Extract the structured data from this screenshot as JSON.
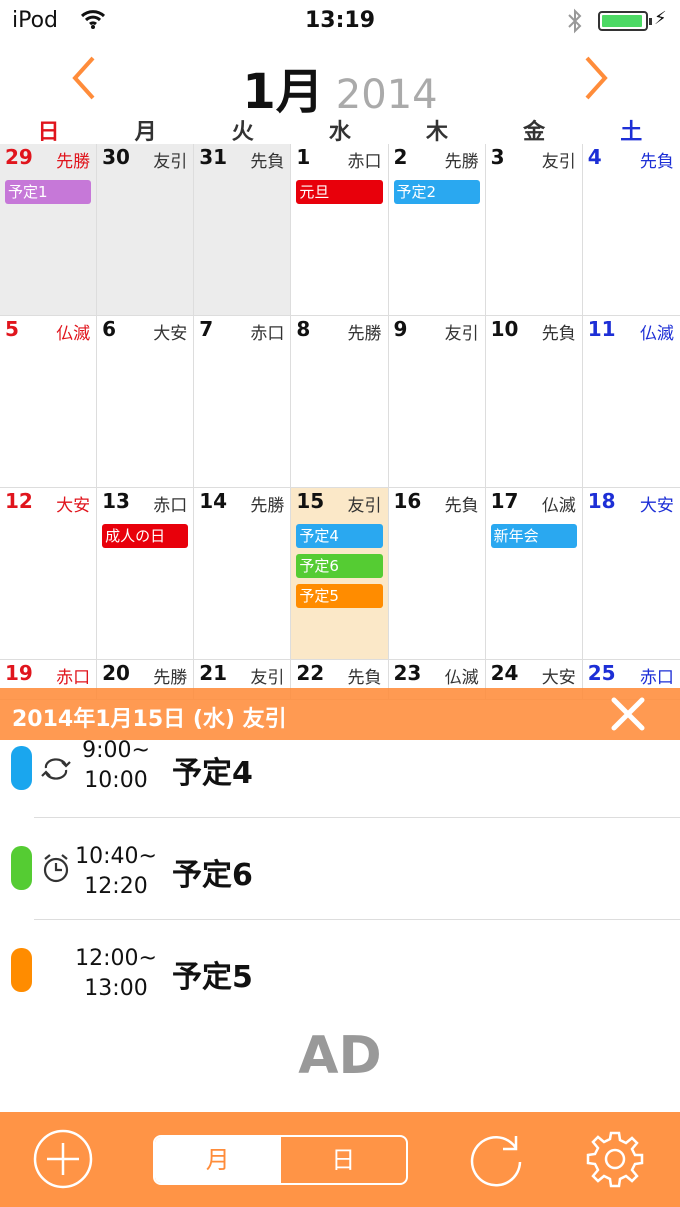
{
  "status_bar": {
    "carrier": "iPod",
    "time": "13:19"
  },
  "header": {
    "month": "1月",
    "year": "2014"
  },
  "weekdays": [
    "日",
    "月",
    "火",
    "水",
    "木",
    "金",
    "土"
  ],
  "weeks": [
    [
      {
        "num": "29",
        "rokuyo": "先勝",
        "events": [
          {
            "label": "予定1",
            "color": "#c678d8"
          }
        ]
      },
      {
        "num": "30",
        "rokuyo": "友引"
      },
      {
        "num": "31",
        "rokuyo": "先負"
      },
      {
        "num": "1",
        "rokuyo": "赤口",
        "events": [
          {
            "label": "元旦",
            "color": "#e8000b"
          }
        ]
      },
      {
        "num": "2",
        "rokuyo": "先勝",
        "events": [
          {
            "label": "予定2",
            "color": "#2aa8f0"
          }
        ]
      },
      {
        "num": "3",
        "rokuyo": "友引"
      },
      {
        "num": "4",
        "rokuyo": "先負"
      }
    ],
    [
      {
        "num": "5",
        "rokuyo": "仏滅"
      },
      {
        "num": "6",
        "rokuyo": "大安"
      },
      {
        "num": "7",
        "rokuyo": "赤口"
      },
      {
        "num": "8",
        "rokuyo": "先勝"
      },
      {
        "num": "9",
        "rokuyo": "友引"
      },
      {
        "num": "10",
        "rokuyo": "先負"
      },
      {
        "num": "11",
        "rokuyo": "仏滅"
      }
    ],
    [
      {
        "num": "12",
        "rokuyo": "大安"
      },
      {
        "num": "13",
        "rokuyo": "赤口",
        "events": [
          {
            "label": "成人の日",
            "color": "#e8000b"
          }
        ]
      },
      {
        "num": "14",
        "rokuyo": "先勝"
      },
      {
        "num": "15",
        "rokuyo": "友引",
        "events": [
          {
            "label": "予定4",
            "color": "#2aa8f0"
          },
          {
            "label": "予定6",
            "color": "#55cc33"
          },
          {
            "label": "予定5",
            "color": "#ff8c00"
          }
        ]
      },
      {
        "num": "16",
        "rokuyo": "先負"
      },
      {
        "num": "17",
        "rokuyo": "仏滅",
        "events": [
          {
            "label": "新年会",
            "color": "#2aa8f0"
          }
        ]
      },
      {
        "num": "18",
        "rokuyo": "大安"
      }
    ],
    [
      {
        "num": "19",
        "rokuyo": "赤口"
      },
      {
        "num": "20",
        "rokuyo": "先勝"
      },
      {
        "num": "21",
        "rokuyo": "友引"
      },
      {
        "num": "22",
        "rokuyo": "先負"
      },
      {
        "num": "23",
        "rokuyo": "仏滅"
      },
      {
        "num": "24",
        "rokuyo": "大安"
      },
      {
        "num": "25",
        "rokuyo": "赤口"
      }
    ]
  ],
  "day_detail": {
    "label": "2014年1月15日 (水)  友引",
    "events": [
      {
        "start": "9:00~",
        "end": "10:00",
        "title": "予定4",
        "color": "#1aa6ee",
        "icon": "repeat-icon"
      },
      {
        "start": "10:40~",
        "end": "12:20",
        "title": "予定6",
        "color": "#55cc33",
        "icon": "alarm-clock-icon"
      },
      {
        "start": "12:00~",
        "end": "13:00",
        "title": "予定5",
        "color": "#ff8c00",
        "icon": ""
      }
    ]
  },
  "ad_text": "AD",
  "toolbar": {
    "month_label": "月",
    "day_label": "日"
  },
  "colors": {
    "accent": "#ff9446",
    "sunday": "#e0151d",
    "saturday": "#1d2fd6",
    "today_bg": "#fbe8c8"
  }
}
